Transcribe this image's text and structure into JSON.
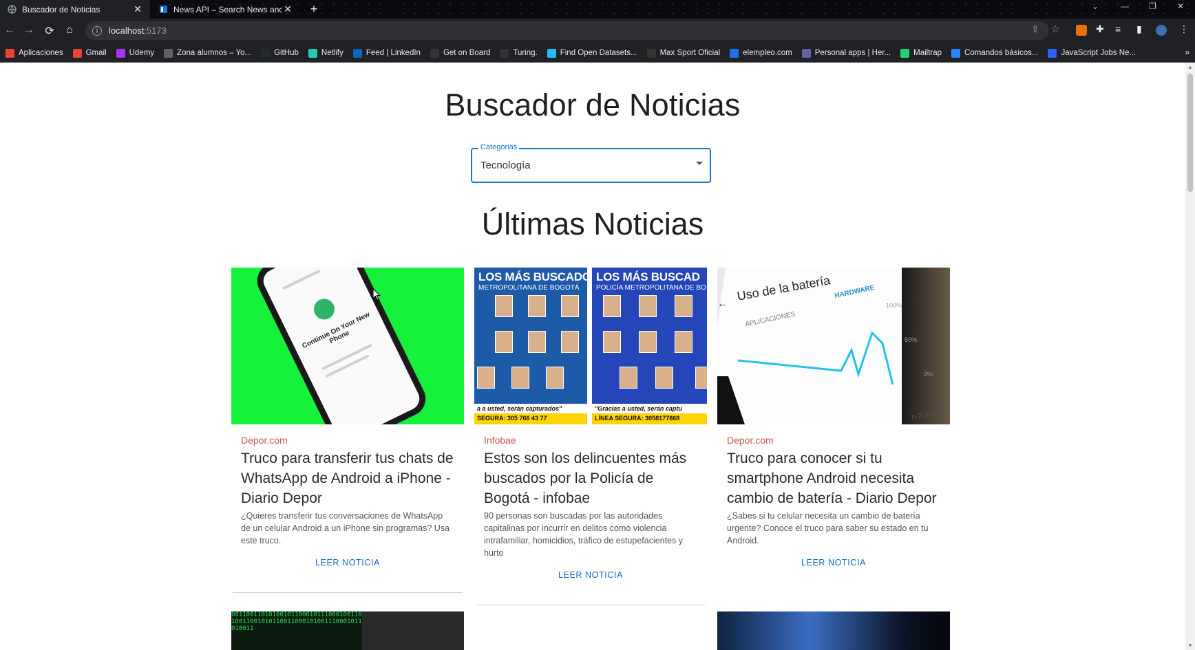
{
  "browser": {
    "tabs": [
      {
        "title": "Buscador de Noticias",
        "active": true
      },
      {
        "title": "News API – Search News and Blo",
        "active": false
      }
    ],
    "url_host": "localhost",
    "url_port": ":5173",
    "bookmarks": [
      {
        "label": "Aplicaciones",
        "icon": "apps-grid-icon",
        "color": "#ea4335"
      },
      {
        "label": "Gmail",
        "icon": "gmail-icon",
        "color": "#ea4335"
      },
      {
        "label": "Udemy",
        "icon": "udemy-icon",
        "color": "#a435f0"
      },
      {
        "label": "Zona alumnos – Yo...",
        "icon": "globe-icon",
        "color": "#5f6368"
      },
      {
        "label": "GitHub",
        "icon": "github-icon",
        "color": "#24292e"
      },
      {
        "label": "Netlify",
        "icon": "netlify-icon",
        "color": "#25c7b7"
      },
      {
        "label": "Feed | LinkedIn",
        "icon": "linkedin-icon",
        "color": "#0a66c2"
      },
      {
        "label": "Get on Board",
        "icon": "getonboard-icon",
        "color": "#333"
      },
      {
        "label": "Turing.",
        "icon": "turing-icon",
        "color": "#333"
      },
      {
        "label": "Find Open Datasets...",
        "icon": "kaggle-icon",
        "color": "#20beff"
      },
      {
        "label": "Max Sport Oficial",
        "icon": "maxsport-icon",
        "color": "#333"
      },
      {
        "label": "elempleo.com",
        "icon": "elempleo-icon",
        "color": "#1a73e8"
      },
      {
        "label": "Personal apps | Her...",
        "icon": "heroku-icon",
        "color": "#6762a6"
      },
      {
        "label": "Mailtrap",
        "icon": "mailtrap-icon",
        "color": "#22d172"
      },
      {
        "label": "Comandos básicos...",
        "icon": "atlassian-icon",
        "color": "#2684ff"
      },
      {
        "label": "JavaScript Jobs Ne...",
        "icon": "jsjobs-icon",
        "color": "#2962ff"
      }
    ]
  },
  "page": {
    "title": "Buscador de Noticias",
    "select": {
      "label": "Categorias",
      "value": "Tecnología"
    },
    "section_title": "Últimas Noticias",
    "cta_label": "LEER NOTICIA"
  },
  "news": [
    {
      "source": "Depor.com",
      "headline": "Truco para transferir tus chats de WhatsApp de Android a iPhone - Diario Depor",
      "description": "¿Quieres transferir tus conversaciones de WhatsApp de un celular Android a un iPhone sin programas? Usa este truco.",
      "image": "phone-transfer-image",
      "phone_text": "Continue On Your New Phone"
    },
    {
      "source": "Infobae",
      "headline": "Estos son los delincuentes más buscados por la Policía de Bogotá - infobae",
      "description": "90 personas son buscadas por las autoridades capitalinas por incurrir en delitos como violencia intrafamiliar, homicidios, tráfico de estupefacientes y hurto",
      "image": "wanted-posters-image",
      "poster_left_title": "LOS MÁS BUSCADOS",
      "poster_left_sub": "METROPOLITANA DE BOGOTÁ",
      "poster_right_title": "LOS MÁS BUSCAD",
      "poster_right_sub": "POLICÍA METROPOLITANA DE BO",
      "poster_left_foot": "a a usted, serán capturados\"",
      "poster_right_foot": "\"Gracias a usted, serán captu",
      "poster_left_line": "SEGURA: 305 766 43 77",
      "poster_right_line": "LÍNEA SEGURA: 3058177868"
    },
    {
      "source": "Depor.com",
      "headline": "Truco para conocer si tu smartphone Android necesita cambio de batería - Diario Depor",
      "description": "¿Sabes si tu celular necesita un cambio de batería urgente? Conoce el truco para saber su estado en tu Android.",
      "image": "battery-usage-image",
      "screen_title": "Uso de la batería",
      "screen_tab_a": "APLICACIONES",
      "screen_tab_b": "HARDWARE",
      "screen_pct_100": "100%",
      "screen_pct_50": "50%",
      "screen_pct_0": "0%",
      "screen_time": "h 2 m 8 s"
    }
  ]
}
